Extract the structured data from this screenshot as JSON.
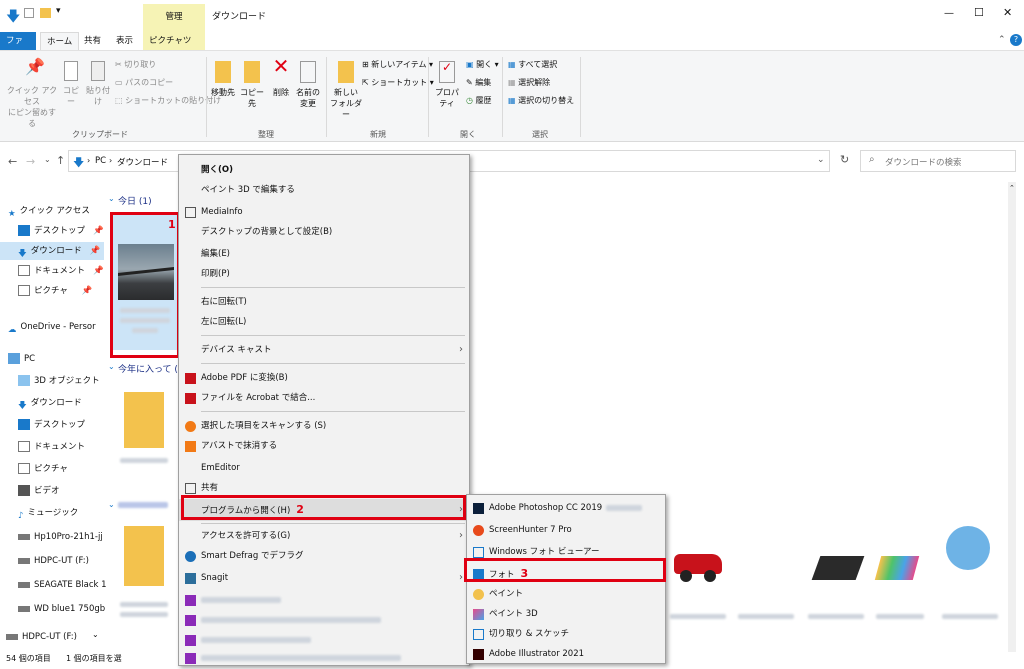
{
  "titlebar": {
    "context_tab": "管理",
    "title": "ダウンロード",
    "minimize": "—",
    "maximize": "☐",
    "close": "✕"
  },
  "tabs": [
    "ファイル",
    "ホーム",
    "共有",
    "表示",
    "ピクチャツール"
  ],
  "ribbon": {
    "clipboard": {
      "pin": "クイック アクセス\nにピン留めする",
      "copy": "コピー",
      "paste": "貼り付け",
      "cut": "切り取り",
      "copy_path": "パスのコピー",
      "paste_shortcut": "ショートカットの貼り付け",
      "label": "クリップボード"
    },
    "organize": {
      "move": "移動先",
      "copy_to": "コピー先",
      "delete": "削除",
      "rename": "名前の\n変更",
      "label": "整理"
    },
    "new": {
      "new_folder": "新しい\nフォルダー",
      "new_item": "新しいアイテム",
      "shortcut": "ショートカット",
      "label": "新規"
    },
    "open": {
      "properties": "プロパティ",
      "open": "開く",
      "edit": "編集",
      "history": "履歴",
      "label": "開く"
    },
    "select": {
      "select_all": "すべて選択",
      "select_none": "選択解除",
      "invert": "選択の切り替え",
      "label": "選択"
    }
  },
  "address": {
    "path_pc": "PC",
    "path_folder": "ダウンロード",
    "search_placeholder": "ダウンロードの検索"
  },
  "nav": {
    "quick_access": "クイック アクセス",
    "desktop": "デスクトップ",
    "downloads": "ダウンロード",
    "documents": "ドキュメント",
    "pictures": "ピクチャ",
    "onedrive": "OneDrive - Persor",
    "pc": "PC",
    "objects3d": "3D オブジェクト",
    "downloads2": "ダウンロード",
    "desktop2": "デスクトップ",
    "documents2": "ドキュメント",
    "pictures2": "ピクチャ",
    "videos": "ビデオ",
    "music": "ミュージック",
    "drive1": "Hp10Pro-21h1-jj",
    "drive2": "HDPC-UT (F:)",
    "drive3": "SEAGATE Black 1",
    "drive4": "WD blue1 750gb",
    "drive5": "HDPC-UT (F:)"
  },
  "content": {
    "group_today": "今日 (1)",
    "group_year": "今年に入って (今",
    "num1": "1",
    "num2": "2",
    "num3": "3"
  },
  "status": {
    "count": "54 個の項目",
    "selected": "1 個の項目を選"
  },
  "context_menu": {
    "open": "開く(O)",
    "paint3d_edit": "ペイント 3D で編集する",
    "mediainfo": "MediaInfo",
    "set_wallpaper": "デスクトップの背景として設定(B)",
    "edit": "編集(E)",
    "print": "印刷(P)",
    "rotate_right": "右に回転(T)",
    "rotate_left": "左に回転(L)",
    "cast": "デバイス キャスト",
    "pdf_convert": "Adobe PDF に変換(B)",
    "acrobat_combine": "ファイルを Acrobat で結合...",
    "scan": "選択した項目をスキャンする (S)",
    "avast_wipe": "アバストで抹消する",
    "emeditor": "EmEditor",
    "share": "共有",
    "open_with": "プログラムから開く(H)",
    "give_access": "アクセスを許可する(G)",
    "defrag": "Smart Defrag でデフラグ",
    "snagit": "Snagit"
  },
  "submenu": {
    "photoshop": "Adobe Photoshop CC 2019",
    "screenhunter": "ScreenHunter 7 Pro",
    "photo_viewer": "Windows フォト ビューアー",
    "photos": "フォト",
    "paint": "ペイント",
    "paint3d": "ペイント 3D",
    "snip": "切り取り & スケッチ",
    "illustrator": "Adobe Illustrator 2021"
  },
  "colors": {
    "accent": "#1979ca",
    "highlight_red": "#e00012",
    "context_tab_bg": "#f6f3b5"
  }
}
